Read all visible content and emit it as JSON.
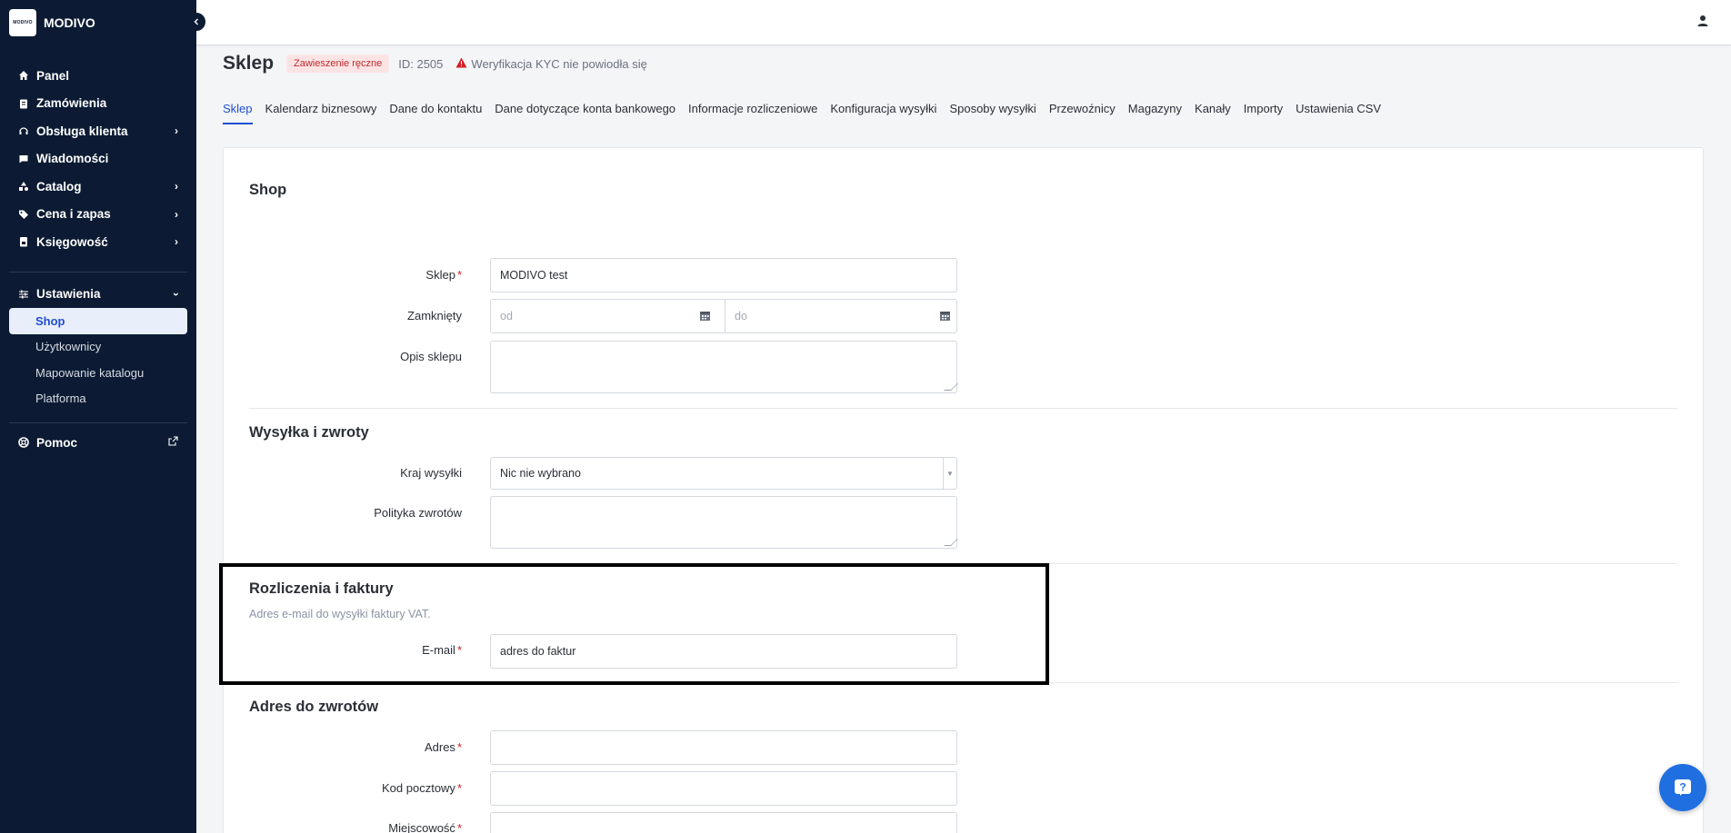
{
  "brand": {
    "logo_text": "MODIVO",
    "name": "MODIVO"
  },
  "sidebar": {
    "items": [
      {
        "label": "Panel",
        "icon": "home-icon"
      },
      {
        "label": "Zamówienia",
        "icon": "clipboard-icon"
      },
      {
        "label": "Obsługa klienta",
        "icon": "headset-icon"
      },
      {
        "label": "Wiadomości",
        "icon": "message-icon"
      },
      {
        "label": "Catalog",
        "icon": "shapes-icon"
      },
      {
        "label": "Cena i zapas",
        "icon": "tag-icon"
      },
      {
        "label": "Księgowość",
        "icon": "invoice-icon"
      }
    ],
    "settings": {
      "label": "Ustawienia",
      "children": [
        "Shop",
        "Użytkownicy",
        "Mapowanie katalogu",
        "Platforma"
      ]
    },
    "help": {
      "label": "Pomoc"
    }
  },
  "header": {
    "title": "Sklep",
    "badge": "Zawieszenie ręczne",
    "shop_id": "ID: 2505",
    "kyc_warning": "Weryfikacja KYC nie powiodła się"
  },
  "tabs": [
    "Sklep",
    "Kalendarz biznesowy",
    "Dane do kontaktu",
    "Dane dotyczące konta bankowego",
    "Informacje rozliczeniowe",
    "Konfiguracja wysyłki",
    "Sposoby wysyłki",
    "Przewoźnicy",
    "Magazyny",
    "Kanały",
    "Importy",
    "Ustawienia CSV"
  ],
  "form": {
    "shop": {
      "title": "Shop",
      "shop_label": "Sklep",
      "shop_value": "MODIVO test",
      "closed_label": "Zamknięty",
      "closed_from_placeholder": "od",
      "closed_to_placeholder": "do",
      "description_label": "Opis sklepu",
      "description_value": ""
    },
    "shipping": {
      "title": "Wysyłka i zwroty",
      "country_label": "Kraj wysyłki",
      "country_value": "Nic nie wybrano",
      "returns_policy_label": "Polityka zwrotów",
      "returns_policy_value": ""
    },
    "billing": {
      "title": "Rozliczenia i faktury",
      "hint": "Adres e-mail do wysyłki faktury VAT.",
      "email_label": "E-mail",
      "email_value": "adres do faktur"
    },
    "returns_address": {
      "title": "Adres do zwrotów",
      "address_label": "Adres",
      "postal_code_label": "Kod pocztowy",
      "city_label": "Miejscowość"
    }
  }
}
